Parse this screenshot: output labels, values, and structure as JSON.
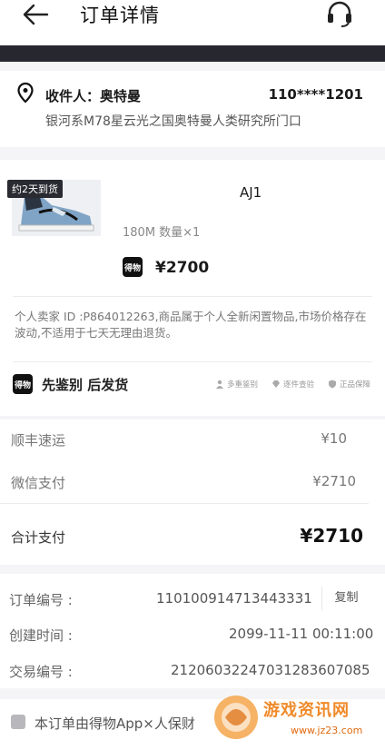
{
  "header": {
    "title": "订单详情",
    "back_icon": "back-arrow-icon",
    "support_icon": "headset-icon"
  },
  "address": {
    "recipient": "收件人：奥特曼",
    "phone": "110****1201",
    "detail": "银河系M78星云光之国奥特曼人类研究所门口",
    "icon": "location-pin-icon"
  },
  "product": {
    "ship_badge": "约2天到货",
    "name": "AJ1",
    "spec": "180M 数量×1",
    "brand_badge": "得物",
    "price": "¥2700",
    "seller_note": "个人卖家 ID :P864012263,商品属于个人全新闲置物品,市场价格存在波动,不适用于七天无理由退货。"
  },
  "authentication": {
    "badge": "得物",
    "title": "先鉴别 后发货",
    "tags": [
      "多重鉴别",
      "逐件查验",
      "正品保障"
    ]
  },
  "payment": {
    "shipping_label": "顺丰速运",
    "shipping_value": "¥10",
    "wechat_label": "微信支付",
    "wechat_value": "¥2710",
    "total_label": "合计支付",
    "total_value": "¥2710"
  },
  "order_info": {
    "number_label": "订单编号 :",
    "number_value": "110100914713443331",
    "copy_label": "复制",
    "created_label": "创建时间 :",
    "created_value": "2099-11-11 00:11:00",
    "trade_label": "交易编号 :",
    "trade_value": "21206032247031283607085"
  },
  "notice": {
    "text": "本订单由得物App×人保财"
  },
  "watermark": {
    "text": "游戏资讯网",
    "url": "www.jz23.com"
  },
  "colors": {
    "dark_band": "#27272f",
    "background": "#f5f5f7",
    "watermark": "#f08a2a"
  }
}
